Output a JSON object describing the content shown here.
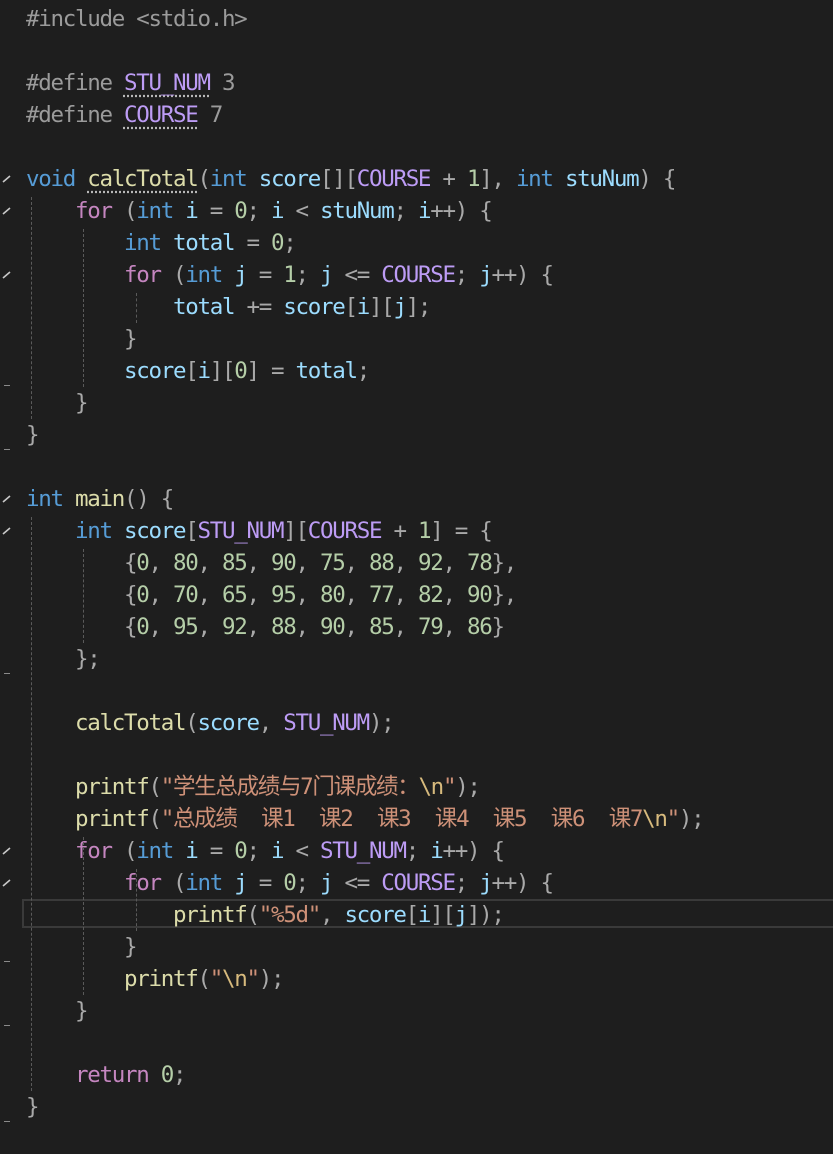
{
  "editor": {
    "language": "C",
    "highlighted_line": 28,
    "colors": {
      "background": "#1e1e1e",
      "keyword": "#569cd6",
      "control": "#c586c0",
      "function": "#dcdcaa",
      "variable": "#9cdcfe",
      "string": "#ce9178",
      "number": "#b5cea8",
      "macro": "#bd9cf5"
    },
    "lines": [
      [
        {
          "t": "pp",
          "v": "#include <stdio.h>"
        }
      ],
      [],
      [
        {
          "t": "pp",
          "v": "#define "
        },
        {
          "t": "mac",
          "v": "STU_NUM"
        },
        {
          "t": "pp",
          "v": " 3"
        }
      ],
      [
        {
          "t": "pp",
          "v": "#define "
        },
        {
          "t": "mac",
          "v": "COURSE"
        },
        {
          "t": "pp",
          "v": " 7"
        }
      ],
      [],
      [
        {
          "t": "kw",
          "v": "void"
        },
        {
          "t": "txt",
          "v": " "
        },
        {
          "t": "fn",
          "v": "calcTotal"
        },
        {
          "t": "dim",
          "v": "("
        },
        {
          "t": "kw",
          "v": "int"
        },
        {
          "t": "txt",
          "v": " "
        },
        {
          "t": "var",
          "v": "score"
        },
        {
          "t": "dim",
          "v": "[]["
        },
        {
          "t": "mac",
          "v": "COURSE"
        },
        {
          "t": "dim",
          "v": " + "
        },
        {
          "t": "num",
          "v": "1"
        },
        {
          "t": "dim",
          "v": "], "
        },
        {
          "t": "kw",
          "v": "int"
        },
        {
          "t": "txt",
          "v": " "
        },
        {
          "t": "var",
          "v": "stuNum"
        },
        {
          "t": "dim",
          "v": ") {"
        }
      ],
      [
        {
          "t": "txt",
          "v": "    "
        },
        {
          "t": "ctl",
          "v": "for"
        },
        {
          "t": "dim",
          "v": " ("
        },
        {
          "t": "kw",
          "v": "int"
        },
        {
          "t": "txt",
          "v": " "
        },
        {
          "t": "var",
          "v": "i"
        },
        {
          "t": "dim",
          "v": " = "
        },
        {
          "t": "num",
          "v": "0"
        },
        {
          "t": "dim",
          "v": "; "
        },
        {
          "t": "var",
          "v": "i"
        },
        {
          "t": "dim",
          "v": " < "
        },
        {
          "t": "var",
          "v": "stuNum"
        },
        {
          "t": "dim",
          "v": "; "
        },
        {
          "t": "var",
          "v": "i"
        },
        {
          "t": "dim",
          "v": "++) {"
        }
      ],
      [
        {
          "t": "txt",
          "v": "        "
        },
        {
          "t": "kw",
          "v": "int"
        },
        {
          "t": "txt",
          "v": " "
        },
        {
          "t": "var",
          "v": "total"
        },
        {
          "t": "dim",
          "v": " = "
        },
        {
          "t": "num",
          "v": "0"
        },
        {
          "t": "dim",
          "v": ";"
        }
      ],
      [
        {
          "t": "txt",
          "v": "        "
        },
        {
          "t": "ctl",
          "v": "for"
        },
        {
          "t": "dim",
          "v": " ("
        },
        {
          "t": "kw",
          "v": "int"
        },
        {
          "t": "txt",
          "v": " "
        },
        {
          "t": "var",
          "v": "j"
        },
        {
          "t": "dim",
          "v": " = "
        },
        {
          "t": "num",
          "v": "1"
        },
        {
          "t": "dim",
          "v": "; "
        },
        {
          "t": "var",
          "v": "j"
        },
        {
          "t": "dim",
          "v": " <= "
        },
        {
          "t": "mac",
          "v": "COURSE"
        },
        {
          "t": "dim",
          "v": "; "
        },
        {
          "t": "var",
          "v": "j"
        },
        {
          "t": "dim",
          "v": "++) {"
        }
      ],
      [
        {
          "t": "txt",
          "v": "            "
        },
        {
          "t": "var",
          "v": "total"
        },
        {
          "t": "dim",
          "v": " += "
        },
        {
          "t": "var",
          "v": "score"
        },
        {
          "t": "dim",
          "v": "["
        },
        {
          "t": "var",
          "v": "i"
        },
        {
          "t": "dim",
          "v": "]["
        },
        {
          "t": "var",
          "v": "j"
        },
        {
          "t": "dim",
          "v": "];"
        }
      ],
      [
        {
          "t": "txt",
          "v": "        "
        },
        {
          "t": "dim",
          "v": "}"
        }
      ],
      [
        {
          "t": "txt",
          "v": "        "
        },
        {
          "t": "var",
          "v": "score"
        },
        {
          "t": "dim",
          "v": "["
        },
        {
          "t": "var",
          "v": "i"
        },
        {
          "t": "dim",
          "v": "]["
        },
        {
          "t": "num",
          "v": "0"
        },
        {
          "t": "dim",
          "v": "] = "
        },
        {
          "t": "var",
          "v": "total"
        },
        {
          "t": "dim",
          "v": ";"
        }
      ],
      [
        {
          "t": "txt",
          "v": "    "
        },
        {
          "t": "dim",
          "v": "}"
        }
      ],
      [
        {
          "t": "dim",
          "v": "}"
        }
      ],
      [],
      [
        {
          "t": "kw",
          "v": "int"
        },
        {
          "t": "txt",
          "v": " "
        },
        {
          "t": "fn",
          "v": "main"
        },
        {
          "t": "dim",
          "v": "() {"
        }
      ],
      [
        {
          "t": "txt",
          "v": "    "
        },
        {
          "t": "kw",
          "v": "int"
        },
        {
          "t": "txt",
          "v": " "
        },
        {
          "t": "var",
          "v": "score"
        },
        {
          "t": "dim",
          "v": "["
        },
        {
          "t": "mac",
          "v": "STU_NUM"
        },
        {
          "t": "dim",
          "v": "]["
        },
        {
          "t": "mac",
          "v": "COURSE"
        },
        {
          "t": "dim",
          "v": " + "
        },
        {
          "t": "num",
          "v": "1"
        },
        {
          "t": "dim",
          "v": "] = {"
        }
      ],
      [
        {
          "t": "txt",
          "v": "        "
        },
        {
          "t": "dim",
          "v": "{"
        },
        {
          "t": "num",
          "v": "0"
        },
        {
          "t": "dim",
          "v": ", "
        },
        {
          "t": "num",
          "v": "80"
        },
        {
          "t": "dim",
          "v": ", "
        },
        {
          "t": "num",
          "v": "85"
        },
        {
          "t": "dim",
          "v": ", "
        },
        {
          "t": "num",
          "v": "90"
        },
        {
          "t": "dim",
          "v": ", "
        },
        {
          "t": "num",
          "v": "75"
        },
        {
          "t": "dim",
          "v": ", "
        },
        {
          "t": "num",
          "v": "88"
        },
        {
          "t": "dim",
          "v": ", "
        },
        {
          "t": "num",
          "v": "92"
        },
        {
          "t": "dim",
          "v": ", "
        },
        {
          "t": "num",
          "v": "78"
        },
        {
          "t": "dim",
          "v": "},"
        }
      ],
      [
        {
          "t": "txt",
          "v": "        "
        },
        {
          "t": "dim",
          "v": "{"
        },
        {
          "t": "num",
          "v": "0"
        },
        {
          "t": "dim",
          "v": ", "
        },
        {
          "t": "num",
          "v": "70"
        },
        {
          "t": "dim",
          "v": ", "
        },
        {
          "t": "num",
          "v": "65"
        },
        {
          "t": "dim",
          "v": ", "
        },
        {
          "t": "num",
          "v": "95"
        },
        {
          "t": "dim",
          "v": ", "
        },
        {
          "t": "num",
          "v": "80"
        },
        {
          "t": "dim",
          "v": ", "
        },
        {
          "t": "num",
          "v": "77"
        },
        {
          "t": "dim",
          "v": ", "
        },
        {
          "t": "num",
          "v": "82"
        },
        {
          "t": "dim",
          "v": ", "
        },
        {
          "t": "num",
          "v": "90"
        },
        {
          "t": "dim",
          "v": "},"
        }
      ],
      [
        {
          "t": "txt",
          "v": "        "
        },
        {
          "t": "dim",
          "v": "{"
        },
        {
          "t": "num",
          "v": "0"
        },
        {
          "t": "dim",
          "v": ", "
        },
        {
          "t": "num",
          "v": "95"
        },
        {
          "t": "dim",
          "v": ", "
        },
        {
          "t": "num",
          "v": "92"
        },
        {
          "t": "dim",
          "v": ", "
        },
        {
          "t": "num",
          "v": "88"
        },
        {
          "t": "dim",
          "v": ", "
        },
        {
          "t": "num",
          "v": "90"
        },
        {
          "t": "dim",
          "v": ", "
        },
        {
          "t": "num",
          "v": "85"
        },
        {
          "t": "dim",
          "v": ", "
        },
        {
          "t": "num",
          "v": "79"
        },
        {
          "t": "dim",
          "v": ", "
        },
        {
          "t": "num",
          "v": "86"
        },
        {
          "t": "dim",
          "v": "}"
        }
      ],
      [
        {
          "t": "txt",
          "v": "    "
        },
        {
          "t": "dim",
          "v": "};"
        }
      ],
      [],
      [
        {
          "t": "txt",
          "v": "    "
        },
        {
          "t": "fn",
          "v": "calcTotal"
        },
        {
          "t": "dim",
          "v": "("
        },
        {
          "t": "var",
          "v": "score"
        },
        {
          "t": "dim",
          "v": ", "
        },
        {
          "t": "mac",
          "v": "STU_NUM"
        },
        {
          "t": "dim",
          "v": ");"
        }
      ],
      [],
      [
        {
          "t": "txt",
          "v": "    "
        },
        {
          "t": "fn",
          "v": "printf"
        },
        {
          "t": "dim",
          "v": "("
        },
        {
          "t": "str",
          "v": "\"学生总成绩与7门课成绩："
        },
        {
          "t": "esc",
          "v": "\\n"
        },
        {
          "t": "str",
          "v": "\""
        },
        {
          "t": "dim",
          "v": ");"
        }
      ],
      [
        {
          "t": "txt",
          "v": "    "
        },
        {
          "t": "fn",
          "v": "printf"
        },
        {
          "t": "dim",
          "v": "("
        },
        {
          "t": "str",
          "v": "\"总成绩  课1  课2  课3  课4  课5  课6  课7"
        },
        {
          "t": "esc",
          "v": "\\n"
        },
        {
          "t": "str",
          "v": "\""
        },
        {
          "t": "dim",
          "v": ");"
        }
      ],
      [
        {
          "t": "txt",
          "v": "    "
        },
        {
          "t": "ctl",
          "v": "for"
        },
        {
          "t": "dim",
          "v": " ("
        },
        {
          "t": "kw",
          "v": "int"
        },
        {
          "t": "txt",
          "v": " "
        },
        {
          "t": "var",
          "v": "i"
        },
        {
          "t": "dim",
          "v": " = "
        },
        {
          "t": "num",
          "v": "0"
        },
        {
          "t": "dim",
          "v": "; "
        },
        {
          "t": "var",
          "v": "i"
        },
        {
          "t": "dim",
          "v": " < "
        },
        {
          "t": "mac",
          "v": "STU_NUM"
        },
        {
          "t": "dim",
          "v": "; "
        },
        {
          "t": "var",
          "v": "i"
        },
        {
          "t": "dim",
          "v": "++) {"
        }
      ],
      [
        {
          "t": "txt",
          "v": "        "
        },
        {
          "t": "ctl",
          "v": "for"
        },
        {
          "t": "dim",
          "v": " ("
        },
        {
          "t": "kw",
          "v": "int"
        },
        {
          "t": "txt",
          "v": " "
        },
        {
          "t": "var",
          "v": "j"
        },
        {
          "t": "dim",
          "v": " = "
        },
        {
          "t": "num",
          "v": "0"
        },
        {
          "t": "dim",
          "v": "; "
        },
        {
          "t": "var",
          "v": "j"
        },
        {
          "t": "dim",
          "v": " <= "
        },
        {
          "t": "mac",
          "v": "COURSE"
        },
        {
          "t": "dim",
          "v": "; "
        },
        {
          "t": "var",
          "v": "j"
        },
        {
          "t": "dim",
          "v": "++) {"
        }
      ],
      [
        {
          "t": "txt",
          "v": "            "
        },
        {
          "t": "fn",
          "v": "printf"
        },
        {
          "t": "dim",
          "v": "("
        },
        {
          "t": "str",
          "v": "\"%5d\""
        },
        {
          "t": "dim",
          "v": ", "
        },
        {
          "t": "var",
          "v": "score"
        },
        {
          "t": "dim",
          "v": "["
        },
        {
          "t": "var",
          "v": "i"
        },
        {
          "t": "dim",
          "v": "]["
        },
        {
          "t": "var",
          "v": "j"
        },
        {
          "t": "dim",
          "v": "]);"
        }
      ],
      [
        {
          "t": "txt",
          "v": "        "
        },
        {
          "t": "dim",
          "v": "}"
        }
      ],
      [
        {
          "t": "txt",
          "v": "        "
        },
        {
          "t": "fn",
          "v": "printf"
        },
        {
          "t": "dim",
          "v": "("
        },
        {
          "t": "str",
          "v": "\""
        },
        {
          "t": "esc",
          "v": "\\n"
        },
        {
          "t": "str",
          "v": "\""
        },
        {
          "t": "dim",
          "v": ");"
        }
      ],
      [
        {
          "t": "txt",
          "v": "    "
        },
        {
          "t": "dim",
          "v": "}"
        }
      ],
      [],
      [
        {
          "t": "txt",
          "v": "    "
        },
        {
          "t": "ctl",
          "v": "return"
        },
        {
          "t": "txt",
          "v": " "
        },
        {
          "t": "num",
          "v": "0"
        },
        {
          "t": "dim",
          "v": ";"
        }
      ],
      [
        {
          "t": "dim",
          "v": "}"
        }
      ]
    ]
  }
}
